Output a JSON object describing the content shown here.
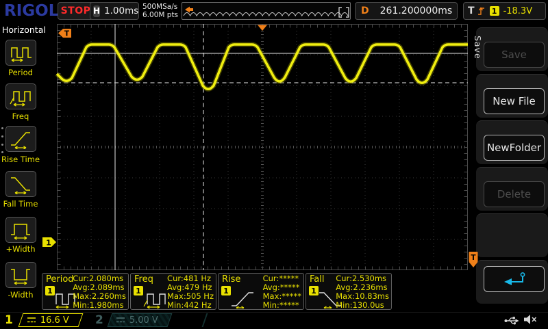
{
  "top_bar": {
    "logo": "RIGOL",
    "run_state": "STOP",
    "timebase": {
      "label": "H",
      "value": "1.00ms"
    },
    "acquisition": {
      "sample_rate": "500MSa/s",
      "memory_depth": "6.00M pts"
    },
    "delay": {
      "label": "D",
      "value": "261.200000ms"
    },
    "trigger": {
      "label": "T",
      "source": "1",
      "level": "-18.3V"
    }
  },
  "sidebar": {
    "title": "Horizontal",
    "items": [
      {
        "label": "Period"
      },
      {
        "label": "Freq"
      },
      {
        "label": "Rise Time"
      },
      {
        "label": "Fall Time"
      },
      {
        "label": "+Width"
      },
      {
        "label": "-Width"
      }
    ]
  },
  "menu": {
    "tab": "Save",
    "buttons": [
      {
        "label": "Save",
        "enabled": false
      },
      {
        "label": "New File",
        "enabled": true
      },
      {
        "label": "NewFolder",
        "enabled": true
      },
      {
        "label": "Delete",
        "enabled": false
      }
    ]
  },
  "measurements": [
    {
      "name": "Period",
      "source": "1",
      "rows": [
        {
          "label": "Cur:",
          "value": "2.080ms"
        },
        {
          "label": "Avg:",
          "value": "2.089ms"
        },
        {
          "label": "Max:",
          "value": "2.260ms"
        },
        {
          "label": "Min:",
          "value": "1.980ms"
        }
      ]
    },
    {
      "name": "Freq",
      "source": "1",
      "rows": [
        {
          "label": "Cur:",
          "value": "481 Hz"
        },
        {
          "label": "Avg:",
          "value": "479 Hz"
        },
        {
          "label": "Max:",
          "value": "505 Hz"
        },
        {
          "label": "Min:",
          "value": "442 Hz"
        }
      ]
    },
    {
      "name": "Rise",
      "source": "1",
      "rows": [
        {
          "label": "Cur:",
          "value": "*****"
        },
        {
          "label": "Avg:",
          "value": "*****"
        },
        {
          "label": "Max:",
          "value": "*****"
        },
        {
          "label": "Min:",
          "value": "*****"
        }
      ]
    },
    {
      "name": "Fall",
      "source": "1",
      "rows": [
        {
          "label": "Cur:",
          "value": "2.530ms"
        },
        {
          "label": "Avg:",
          "value": "2.236ms"
        },
        {
          "label": "Max:",
          "value": "10.83ms"
        },
        {
          "label": "Min:",
          "value": "130.0us"
        }
      ]
    }
  ],
  "channels": [
    {
      "number": "1",
      "coupling": "DC",
      "scale": "16.6 V",
      "active": true
    },
    {
      "number": "2",
      "coupling": "DC",
      "scale": "5.00 V",
      "active": false
    }
  ],
  "graticule": {
    "trigger_marker": "T",
    "offscreen_trigger_marker": "T",
    "channel_marker": "1"
  },
  "colors": {
    "waveform_yellow": "#f0ee10",
    "accent_yellow": "#e8e000",
    "trigger_orange": "#f08019",
    "stop_red": "#ff2a2a",
    "logo_blue": "#2b3aa0",
    "return_cyan": "#18b8e8"
  }
}
